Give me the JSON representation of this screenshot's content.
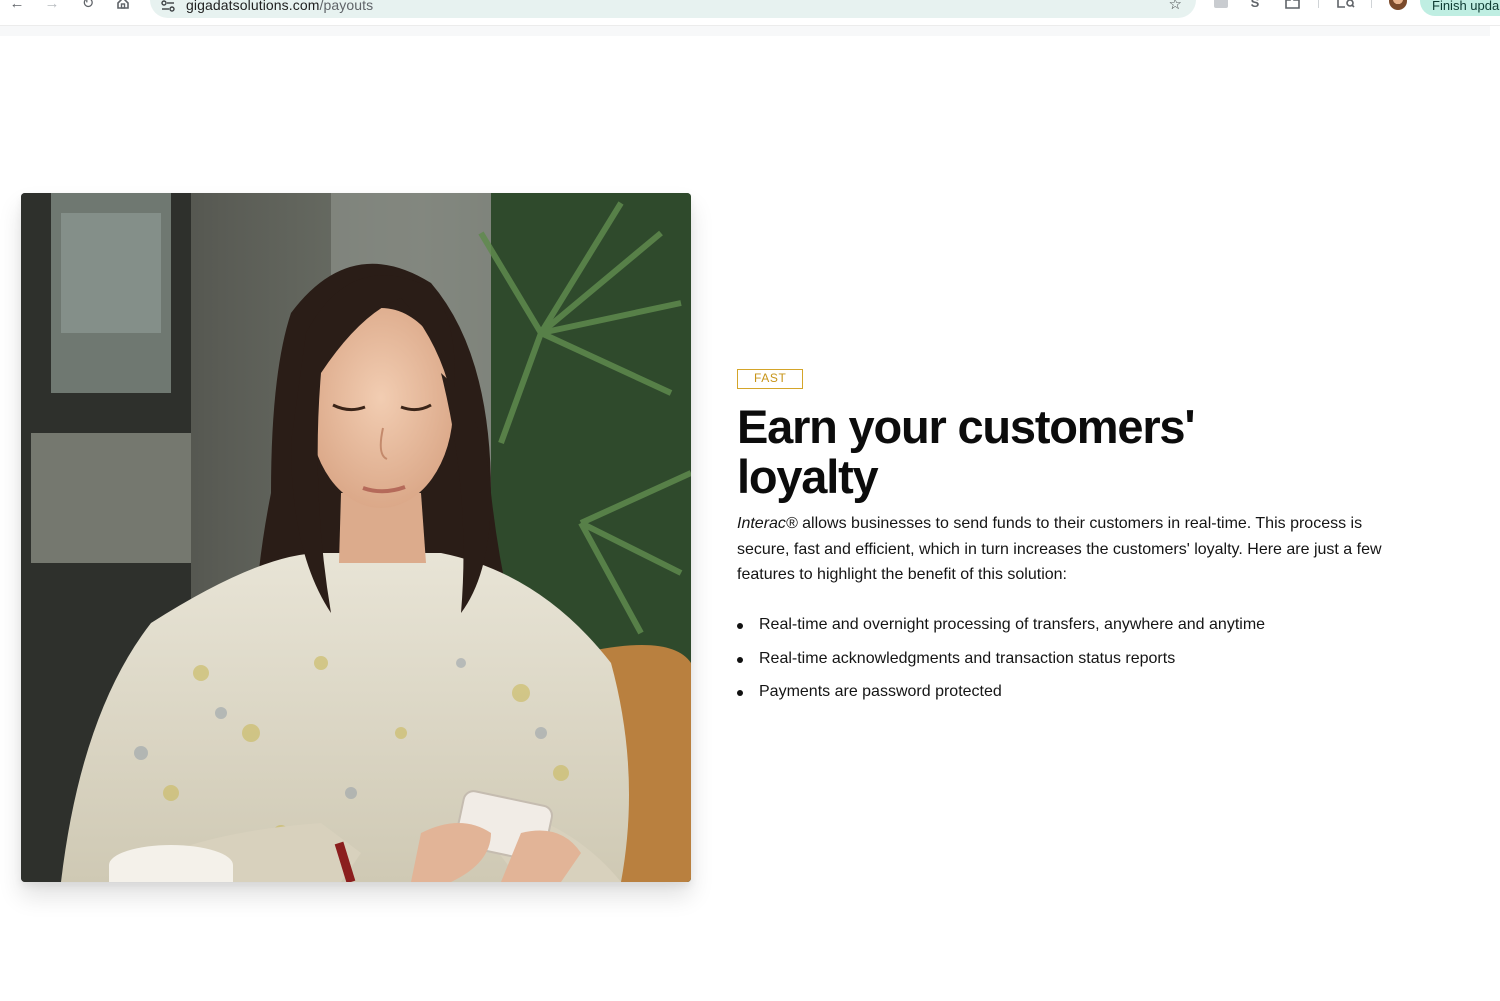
{
  "browser": {
    "url_domain": "gigadatsolutions.com",
    "url_path": "/payouts",
    "finish_update_label": "Finish upda",
    "extension_s_label": "S"
  },
  "section": {
    "tag": "FAST",
    "heading": "Earn your customers' loyalty",
    "intro_brand": "Interac®",
    "intro_text": " allows businesses to send funds to their customers in real-time. This process is secure, fast and efficient, which in turn increases the customers' loyalty. Here are just a few features to highlight the benefit of this solution:",
    "features": [
      "Real-time and overnight processing of transfers, anywhere and anytime",
      "Real-time acknowledgments and transaction status reports",
      "Payments are password protected"
    ]
  },
  "colors": {
    "tag_accent": "#d4a52a",
    "heading": "#0c0c0c",
    "omnibox_bg": "#e7f2f0",
    "update_pill": "#bfeee2"
  }
}
